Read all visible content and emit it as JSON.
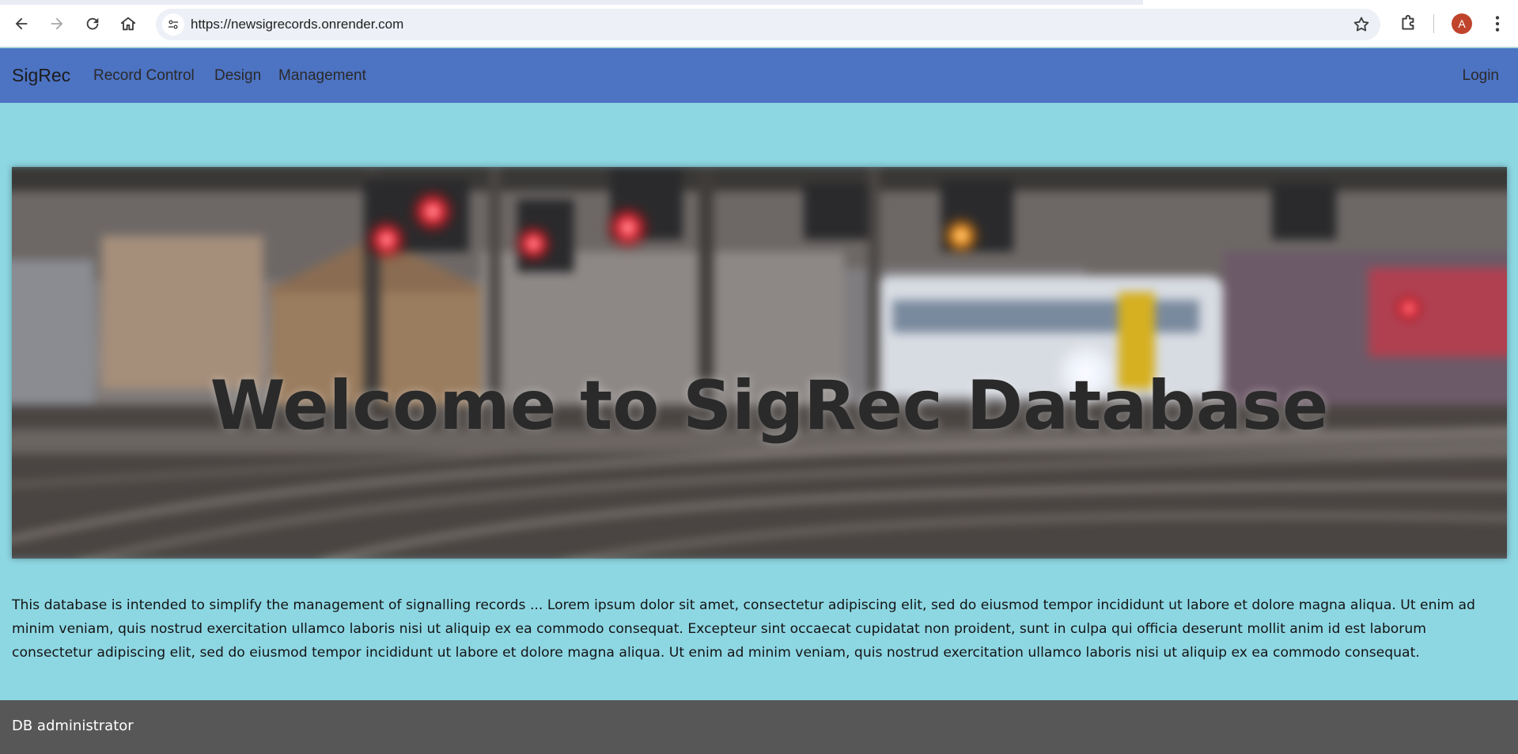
{
  "browser": {
    "url": "https://newsigrecords.onrender.com",
    "profile_initial": "A",
    "icons": [
      "back-arrow-icon",
      "forward-arrow-icon",
      "reload-icon",
      "home-icon",
      "site-settings-icon",
      "bookmark-star-icon",
      "extensions-puzzle-icon",
      "kebab-menu-icon"
    ]
  },
  "navbar": {
    "brand": "SigRec",
    "links": [
      "Record Control",
      "Design",
      "Management"
    ],
    "login": "Login",
    "bg_color": "#4d73c3"
  },
  "hero": {
    "title": "Welcome to SigRec Database"
  },
  "intro": {
    "text": "This database is intended to simplify the management of signalling records ... Lorem ipsum dolor sit amet, consectetur adipiscing elit, sed do eiusmod tempor incididunt ut labore et dolore magna aliqua. Ut enim ad minim veniam, quis nostrud exercitation ullamco laboris nisi ut aliquip ex ea commodo consequat. Excepteur sint occaecat cupidatat non proident, sunt in culpa qui officia deserunt mollit anim id est laborum consectetur adipiscing elit, sed do eiusmod tempor incididunt ut labore et dolore magna aliqua. Ut enim ad minim veniam, quis nostrud exercitation ullamco laboris nisi ut aliquip ex ea commodo consequat."
  },
  "footer": {
    "text": "DB administrator"
  },
  "colors": {
    "page_bg": "#8dd7e3",
    "footer_bg": "#575757"
  }
}
